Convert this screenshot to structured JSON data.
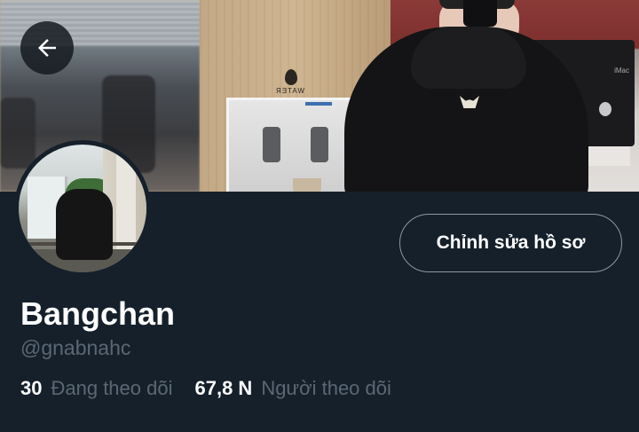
{
  "header": {
    "back_label": "Back",
    "banner_water_text": "WATER"
  },
  "profile": {
    "display_name": "Bangchan",
    "handle": "@gnabnahc",
    "edit_button_label": "Chỉnh sửa hồ sơ",
    "following_count": "30",
    "following_label": "Đang theo dõi",
    "followers_count": "67,8 N",
    "followers_label": "Người theo dõi"
  },
  "icons": {
    "back": "arrow-left-icon"
  },
  "colors": {
    "background": "#15202b",
    "text_primary": "#ffffff",
    "text_secondary": "#5b6873",
    "button_border": "#8b98a5"
  }
}
